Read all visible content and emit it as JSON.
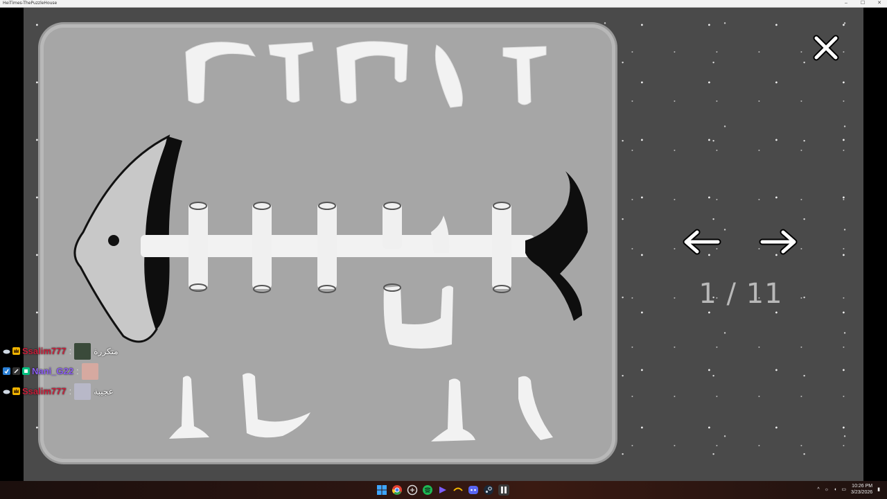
{
  "window": {
    "title": "HeiTimes-ThePuzzleHouse",
    "minimize": "–",
    "maximize": "☐",
    "close": "✕"
  },
  "game": {
    "page_counter": "1 / 11",
    "close_icon": "close-x-icon",
    "prev_icon": "arrow-left-icon",
    "next_icon": "arrow-right-icon"
  },
  "chat": {
    "messages": [
      {
        "user": "Ssalim777",
        "separator": ":",
        "text": "متكررة",
        "color": "#c81e3a"
      },
      {
        "user": "Nani_G22",
        "separator": ":",
        "text": "",
        "color": "#8a5cf0"
      },
      {
        "user": "Ssalim777",
        "separator": ":",
        "text": "عجيبة",
        "color": "#c81e3a"
      }
    ]
  },
  "taskbar": {
    "time": "10:26 PM",
    "date": "3/23/2026",
    "apps": [
      "windows-start-icon",
      "chrome-icon",
      "app-icon",
      "spotify-icon",
      "arrow-app-icon",
      "app-icon",
      "discord-icon",
      "steam-icon",
      "app-icon"
    ]
  }
}
